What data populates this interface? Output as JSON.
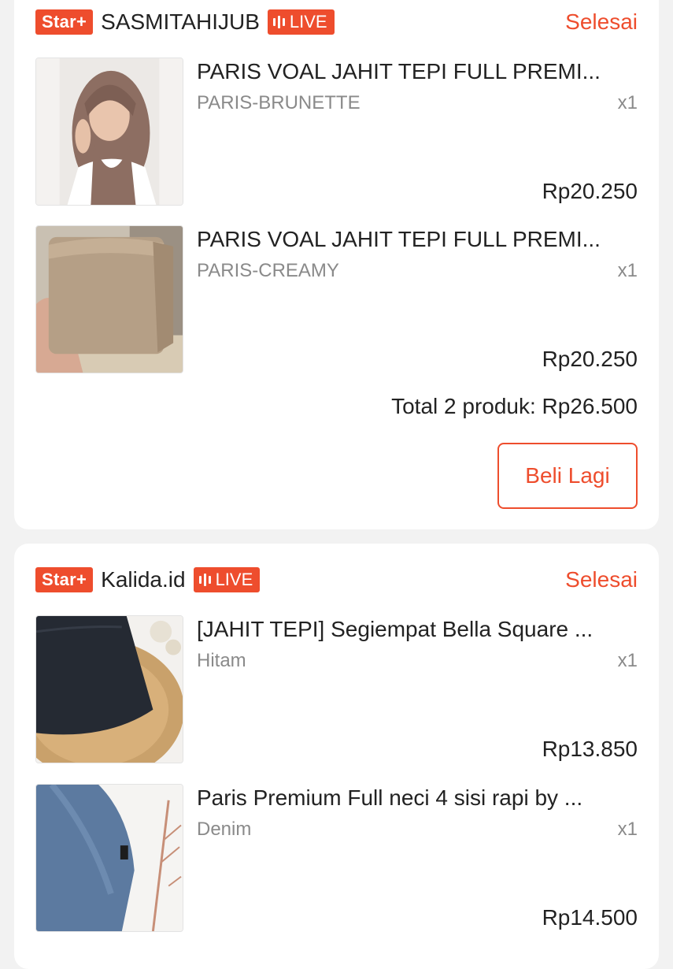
{
  "colors": {
    "accent": "#ee4d2d",
    "muted": "#8a8a8a",
    "background": "#f2f2f2"
  },
  "orders": [
    {
      "star_label": "Star+",
      "shop_name": "SASMITAHIJUB",
      "live_label": "LIVE",
      "status": "Selesai",
      "items": [
        {
          "title": "PARIS VOAL JAHIT TEPI FULL PREMI...",
          "variant": "PARIS-BRUNETTE",
          "qty": "x1",
          "price": "Rp20.250"
        },
        {
          "title": "PARIS VOAL JAHIT TEPI FULL PREMI...",
          "variant": "PARIS-CREAMY",
          "qty": "x1",
          "price": "Rp20.250"
        }
      ],
      "total": "Total 2 produk: Rp26.500",
      "buy_again_label": "Beli Lagi"
    },
    {
      "star_label": "Star+",
      "shop_name": "Kalida.id",
      "live_label": "LIVE",
      "status": "Selesai",
      "items": [
        {
          "title": "[JAHIT TEPI] Segiempat Bella Square ...",
          "variant": "Hitam",
          "qty": "x1",
          "price": "Rp13.850"
        },
        {
          "title": "Paris Premium Full neci 4 sisi rapi by ...",
          "variant": "Denim",
          "qty": "x1",
          "price": "Rp14.500"
        }
      ]
    }
  ]
}
